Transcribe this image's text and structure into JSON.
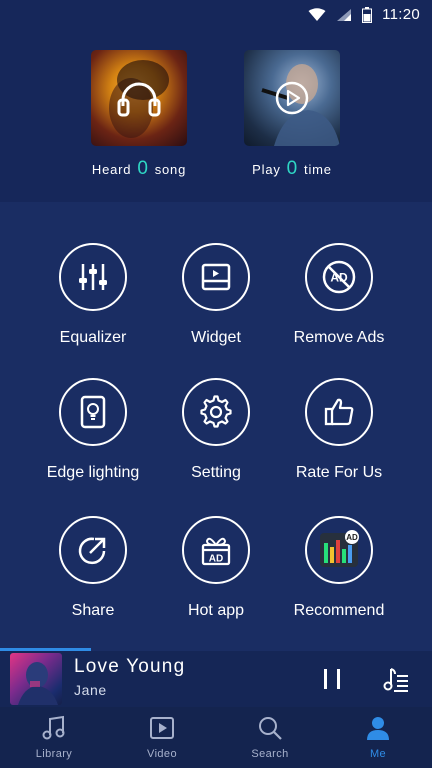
{
  "status_bar": {
    "time": "11:20"
  },
  "stats": {
    "heard": {
      "prefix": "Heard",
      "count": "0",
      "suffix": "song"
    },
    "play": {
      "prefix": "Play",
      "count": "0",
      "suffix": "time"
    }
  },
  "menu": {
    "equalizer": "Equalizer",
    "widget": "Widget",
    "remove_ads": "Remove Ads",
    "edge_lighting": "Edge lighting",
    "setting": "Setting",
    "rate": "Rate For Us",
    "share": "Share",
    "hot_app": "Hot app",
    "recommend": "Recommend"
  },
  "player": {
    "title": "Love Young",
    "artist": "Jane",
    "progress": 0.21
  },
  "nav": {
    "library": "Library",
    "video": "Video",
    "search": "Search",
    "me": "Me"
  },
  "colors": {
    "accent": "#2f8ce6",
    "stat_count": "#2fd6c4",
    "background": "#1a2d63"
  }
}
